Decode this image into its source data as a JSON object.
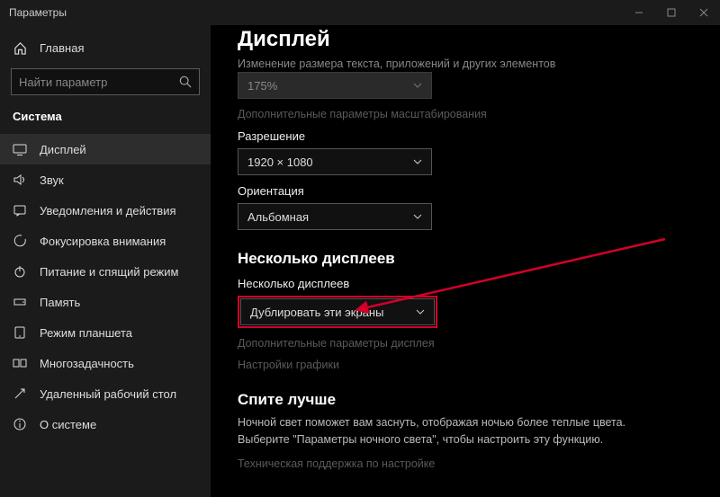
{
  "titlebar": {
    "title": "Параметры"
  },
  "sidebar": {
    "home_label": "Главная",
    "search_placeholder": "Найти параметр",
    "category": "Система",
    "items": [
      {
        "label": "Дисплей"
      },
      {
        "label": "Звук"
      },
      {
        "label": "Уведомления и действия"
      },
      {
        "label": "Фокусировка внимания"
      },
      {
        "label": "Питание и спящий режим"
      },
      {
        "label": "Память"
      },
      {
        "label": "Режим планшета"
      },
      {
        "label": "Многозадачность"
      },
      {
        "label": "Удаленный рабочий стол"
      },
      {
        "label": "О системе"
      }
    ]
  },
  "main": {
    "title": "Дисплей",
    "scale_caption": "Изменение размера текста, приложений и других элементов",
    "scale_value": "175%",
    "scale_link": "Дополнительные параметры масштабирования",
    "resolution_label": "Разрешение",
    "resolution_value": "1920 × 1080",
    "orientation_label": "Ориентация",
    "orientation_value": "Альбомная",
    "multi_head": "Несколько дисплеев",
    "multi_label": "Несколько дисплеев",
    "multi_value": "Дублировать эти экраны",
    "multi_link1": "Дополнительные параметры дисплея",
    "multi_link2": "Настройки графики",
    "sleep_head": "Спите лучше",
    "sleep_para": "Ночной свет поможет вам заснуть, отображая ночью более теплые цвета. Выберите \"Параметры ночного света\", чтобы настроить эту функцию.",
    "tech_link": "Техническая поддержка по настройке"
  }
}
